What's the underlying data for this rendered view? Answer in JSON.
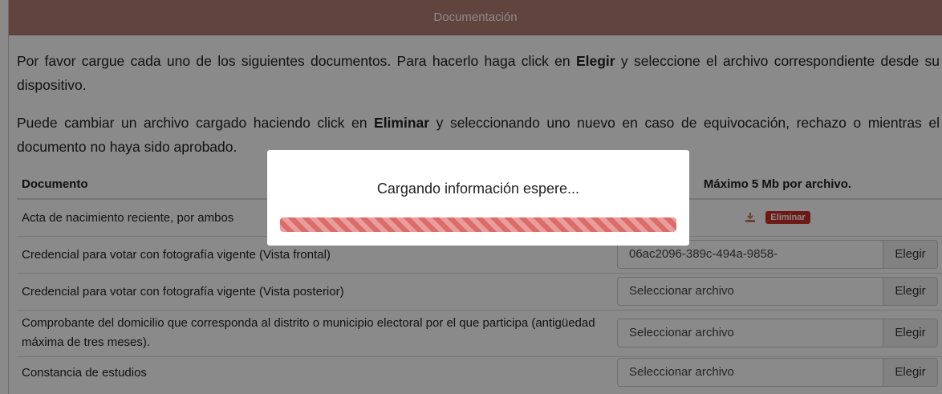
{
  "panel": {
    "title": "Documentación",
    "intro1_a": "Por favor cargue cada uno de los siguientes documentos. Para hacerlo haga click en ",
    "intro1_b": "Elegir",
    "intro1_c": " y seleccione el archivo correspondiente desde su dispositivo.",
    "intro2_a": "Puede cambiar un archivo cargado haciendo click en ",
    "intro2_b": "Eliminar",
    "intro2_c": " y seleccionando uno nuevo en caso de equivocación, rechazo o mientras el documento no haya sido aprobado."
  },
  "table": {
    "col_document": "Documento",
    "col_max": "Máximo 5 Mb por archivo.",
    "rows": [
      {
        "label": "Acta de nacimiento reciente, por ambos",
        "delete_label": "Eliminar",
        "download_icon": "download-icon"
      },
      {
        "label": "Credencial para votar con fotografía vigente (Vista frontal)",
        "file_value": "06ac2096-389c-494a-9858-",
        "choose_label": "Elegir"
      },
      {
        "label": "Credencial para votar con fotografía vigente (Vista posterior)",
        "file_value": "Seleccionar archivo",
        "choose_label": "Elegir"
      },
      {
        "label": "Comprobante del domicilio que corresponda al distrito o municipio electoral por el que participa (antigüedad máxima de tres meses).",
        "file_value": "Seleccionar archivo",
        "choose_label": "Elegir"
      },
      {
        "label": "Constancia de estudios",
        "file_value": "Seleccionar archivo",
        "choose_label": "Elegir"
      }
    ]
  },
  "modal": {
    "message": "Cargando información espere...",
    "progress_percent": 100
  },
  "colors": {
    "header_bg": "#b27e71",
    "danger": "#c9302c",
    "progress": "#d9534f"
  }
}
